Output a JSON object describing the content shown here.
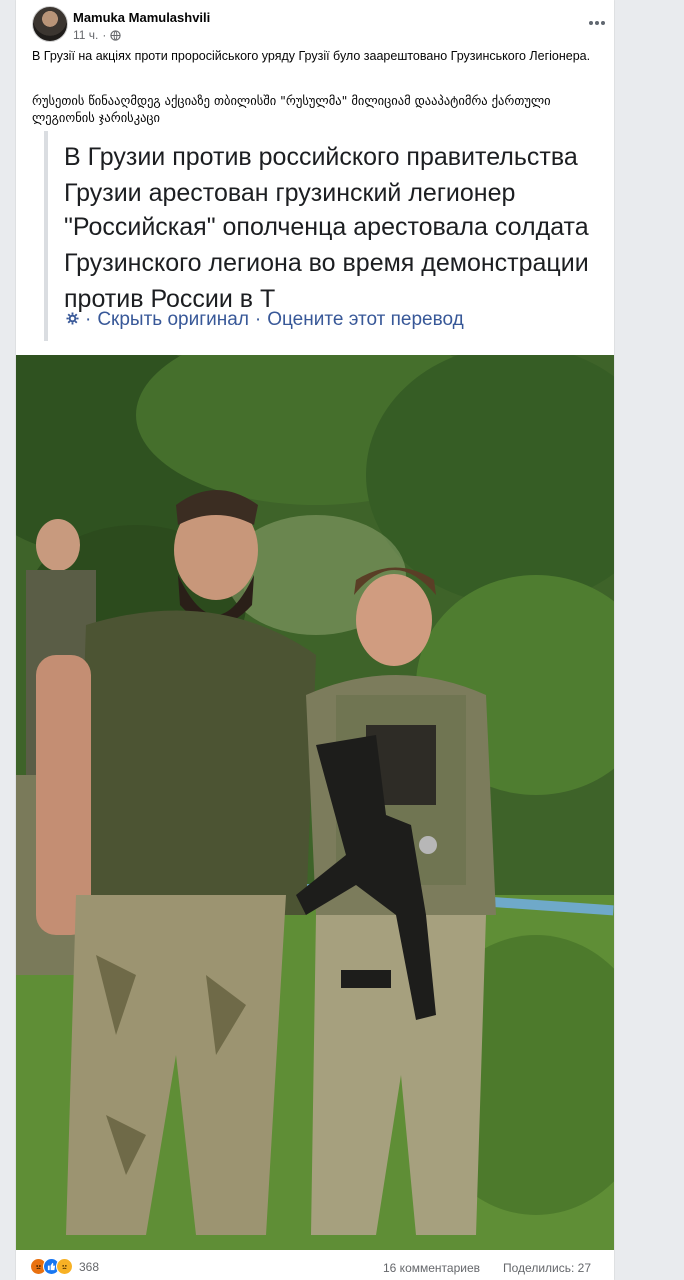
{
  "post": {
    "author": "Mamuka Mamulashvili",
    "time": "11 ч.",
    "text": "В Грузії на акціях проти проросійського уряду Грузії було заарештовано Грузинського Легіонера.",
    "original_text": "რუსეთის წინააღმდეგ აქციაზე თბილისში \"რუსულმა\" მილიციამ დააპატიმრა ქართული ლეგიონის ჯარისკაცი"
  },
  "translation": {
    "lines": [
      "В Грузии против российского правительства Грузии арестован грузинский легионер",
      "\"Российская\" ополченца арестовала солдата Грузинского легиона во время демонстрации против России в Т"
    ],
    "hide_original": "Скрыть оригинал",
    "separator": "·",
    "rate": "Оцените этот перевод"
  },
  "footer": {
    "reactions_count": "368",
    "comments": "16 комментариев",
    "shares": "Поделились: 27"
  },
  "icons": {
    "globe": "globe-icon",
    "more": "more-options-icon",
    "gear": "gear-icon",
    "reactions": [
      "angry-reaction-icon",
      "like-reaction-icon",
      "sad-reaction-icon"
    ]
  },
  "colors": {
    "link": "#385898",
    "meta": "#65676b",
    "angry": "#e9710f",
    "like": "#1877f2",
    "sad": "#f7b125"
  }
}
